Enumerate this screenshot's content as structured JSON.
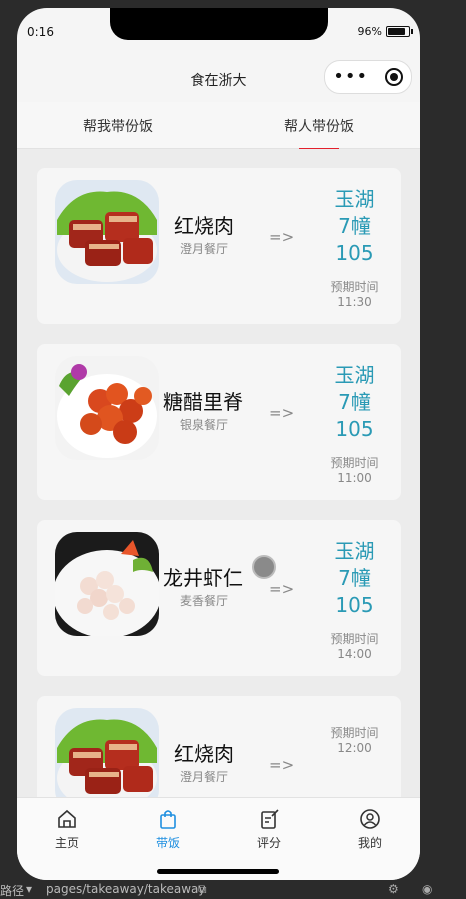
{
  "status": {
    "time": "0:16",
    "battery": "96%"
  },
  "nav": {
    "title": "食在浙大"
  },
  "tabs": [
    {
      "label": "帮我带份饭",
      "active": false
    },
    {
      "label": "帮人带份饭",
      "active": true
    }
  ],
  "orders": [
    {
      "dish": "红烧肉",
      "restaurant": "澄月餐厅",
      "arrow": "=>",
      "location": [
        "玉湖",
        "7幢",
        "105"
      ],
      "eta_label": "预期时间",
      "eta": "11:30",
      "image": "braised-pork-image"
    },
    {
      "dish": "糖醋里脊",
      "restaurant": "银泉餐厅",
      "arrow": "=>",
      "location": [
        "玉湖",
        "7幢",
        "105"
      ],
      "eta_label": "预期时间",
      "eta": "11:00",
      "image": "sweet-sour-pork-image"
    },
    {
      "dish": "龙井虾仁",
      "restaurant": "麦香餐厅",
      "arrow": "=>",
      "location": [
        "玉湖",
        "7幢",
        "105"
      ],
      "eta_label": "预期时间",
      "eta": "14:00",
      "image": "shrimp-image"
    },
    {
      "dish": "红烧肉",
      "restaurant": "澄月餐厅",
      "arrow": "=>",
      "location": [],
      "eta_label": "预期时间",
      "eta": "12:00",
      "image": "braised-pork-image"
    }
  ],
  "bottom_nav": [
    {
      "label": "主页",
      "icon": "home-icon",
      "active": false
    },
    {
      "label": "带饭",
      "icon": "bag-icon",
      "active": true
    },
    {
      "label": "评分",
      "icon": "edit-icon",
      "active": false
    },
    {
      "label": "我的",
      "icon": "user-icon",
      "active": false
    }
  ],
  "devtools": {
    "path_label": "路径",
    "path": "pages/takeaway/takeaway"
  },
  "colors": {
    "accent_tab": "#e3202c",
    "location": "#2a9ab5",
    "active_nav": "#1e8fe0"
  }
}
